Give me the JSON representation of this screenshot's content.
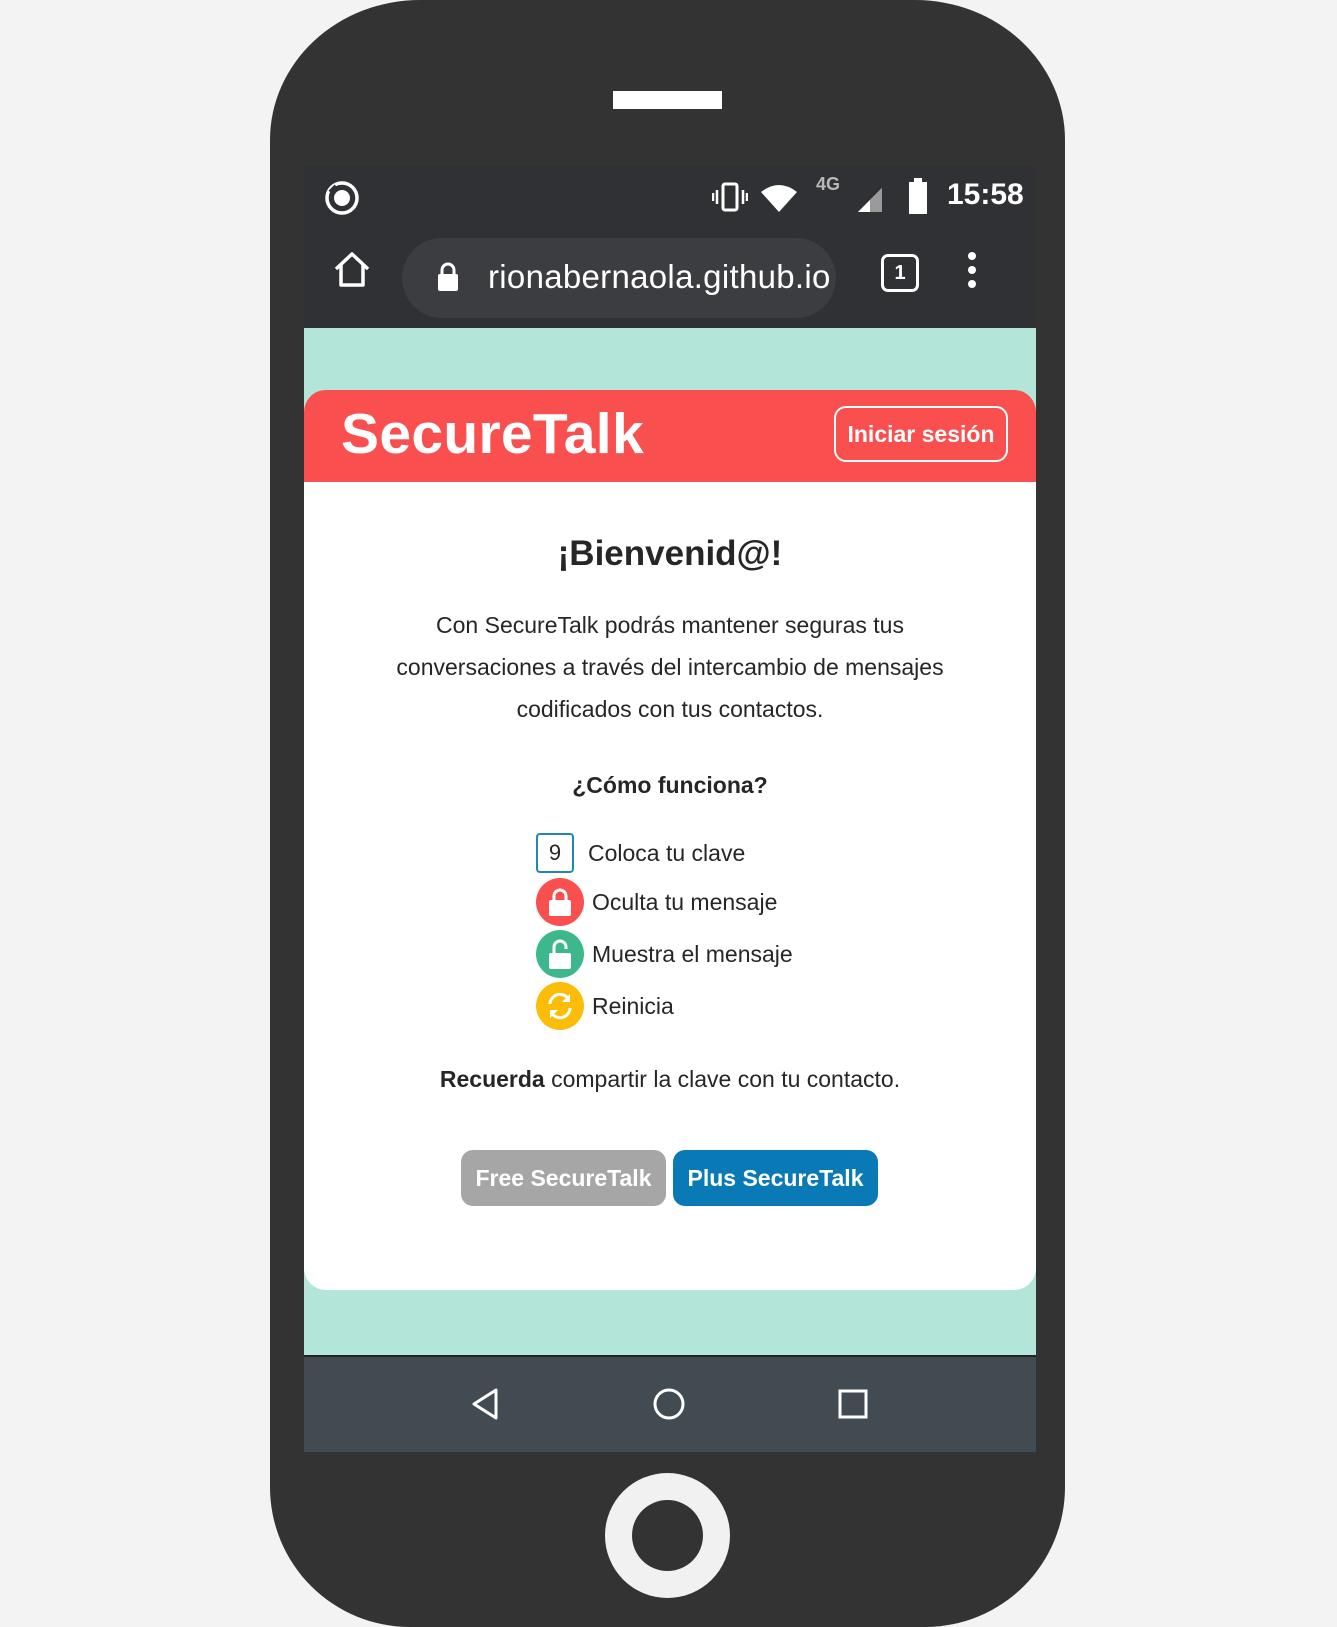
{
  "status_bar": {
    "time": "15:58",
    "network": "4G",
    "icons": [
      "sync-icon",
      "vibrate-icon",
      "wifi-icon",
      "signal-icon",
      "battery-icon"
    ]
  },
  "browser": {
    "url": "rionabernaola.github.io",
    "tab_count": "1",
    "icons": [
      "home-icon",
      "lock-icon",
      "tabs-icon",
      "menu-icon"
    ]
  },
  "header": {
    "brand": "SecureTalk",
    "login_label": "Iniciar sesión",
    "color": "#fa4f4f"
  },
  "main": {
    "welcome": "¡Bienvenid@!",
    "intro": "Con SecureTalk podrás mantener seguras tus conversaciones a través del intercambio de mensajes codificados con tus contactos.",
    "how_title": "¿Cómo funciona?",
    "steps": [
      {
        "icon": "key-number-icon",
        "value": "9",
        "label": "Coloca tu clave"
      },
      {
        "icon": "lock-closed-icon",
        "label": "Oculta tu mensaje",
        "color": "#fa4f4f"
      },
      {
        "icon": "lock-open-icon",
        "label": "Muestra el mensaje",
        "color": "#3db88a"
      },
      {
        "icon": "refresh-icon",
        "label": "Reinicia",
        "color": "#fbbd08"
      }
    ],
    "remember_bold": "Recuerda",
    "remember_rest": " compartir la clave con tu contacto.",
    "buttons": {
      "free": "Free SecureTalk",
      "plus": "Plus SecureTalk"
    }
  },
  "nav": {
    "icons": [
      "back-icon",
      "home-circle-icon",
      "recents-icon"
    ]
  },
  "colors": {
    "page_bg": "#b3e5d8",
    "plus_button": "#0a7ab6",
    "free_button": "#a6a6a6"
  }
}
